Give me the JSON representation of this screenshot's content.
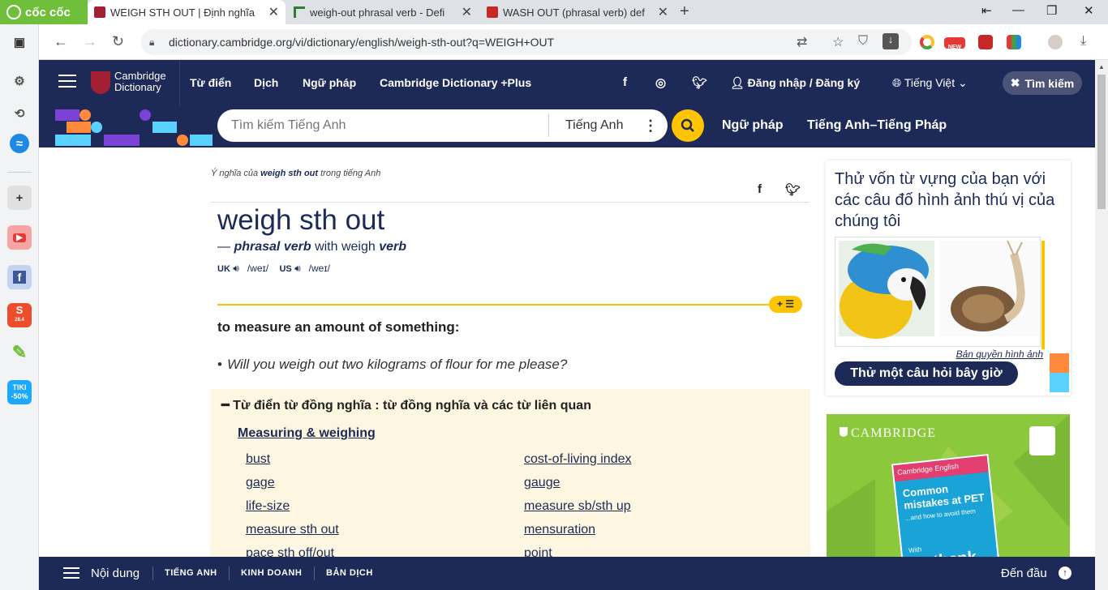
{
  "browser": {
    "brand": "cốc cốc",
    "tabs": [
      {
        "title": "WEIGH STH OUT | Định nghĩa",
        "active": true
      },
      {
        "title": "weigh-out phrasal verb - Defi",
        "active": false
      },
      {
        "title": "WASH OUT (phrasal verb) def",
        "active": false
      }
    ],
    "url": "dictionary.cambridge.org/vi/dictionary/english/weigh-sth-out?q=WEIGH+OUT",
    "ext_badge_new": "NEW",
    "sidebar_shopee_badge": "28.4",
    "sidebar_tiki": "TIKI",
    "sidebar_tiki_discount": "-50%"
  },
  "site": {
    "logo_line1": "Cambridge",
    "logo_line2": "Dictionary",
    "nav": [
      "Từ điển",
      "Dịch",
      "Ngữ pháp",
      "Cambridge Dictionary +Plus"
    ],
    "login": "Đăng nhập / Đăng ký",
    "language": "Tiếng Việt",
    "search_toggle": "Tìm kiếm",
    "search_placeholder": "Tìm kiếm Tiếng Anh",
    "search_dict": "Tiếng Anh",
    "sub_links": [
      "Ngữ pháp",
      "Tiếng Anh–Tiếng Pháp"
    ],
    "accent": "#fec400",
    "brand_color": "#1d2a57"
  },
  "entry": {
    "crumb_prefix": "Ý nghĩa của",
    "crumb_word": "weigh sth out",
    "crumb_suffix": "trong tiếng Anh",
    "headword": "weigh sth out",
    "pos_dash": "—",
    "pos": "phrasal verb",
    "pos_with": "with weigh",
    "pos_verb": "verb",
    "uk_label": "UK",
    "uk_ipa": "/weɪ/",
    "us_label": "US",
    "us_ipa": "/weɪ/",
    "definition": "to measure an amount of something:",
    "example": "Will you weigh out two kilograms of flour for me please?",
    "thesaurus_heading": "Từ điển từ đồng nghĩa : từ đồng nghĩa và các từ liên quan",
    "thesaurus_topic": "Measuring & weighing",
    "thesaurus_left": [
      "bust",
      "gage",
      "life-size",
      "measure sth out",
      "pace sth off/out"
    ],
    "thesaurus_right": [
      "cost-of-living index",
      "gauge",
      "measure sb/sth up",
      "mensuration",
      "point"
    ]
  },
  "quiz": {
    "text": "Thử vốn từ vựng của bạn với các câu đố hình ảnh thú vị của chúng tôi",
    "credit": "Bản quyền hình ảnh",
    "button": "Thử một câu hỏi bây giờ"
  },
  "ad": {
    "brand": "CAMBRIDGE",
    "book_band": "Cambridge English",
    "book_title": "Common mistakes at PET",
    "book_sub": "...and how to avoid them",
    "book_with": "With",
    "book_bottom": "Testbank"
  },
  "bottom_bar": {
    "contents": "Nội dung",
    "links": [
      "TIẾNG ANH",
      "KINH DOANH",
      "BẢN DỊCH"
    ],
    "to_top": "Đến đầu"
  }
}
